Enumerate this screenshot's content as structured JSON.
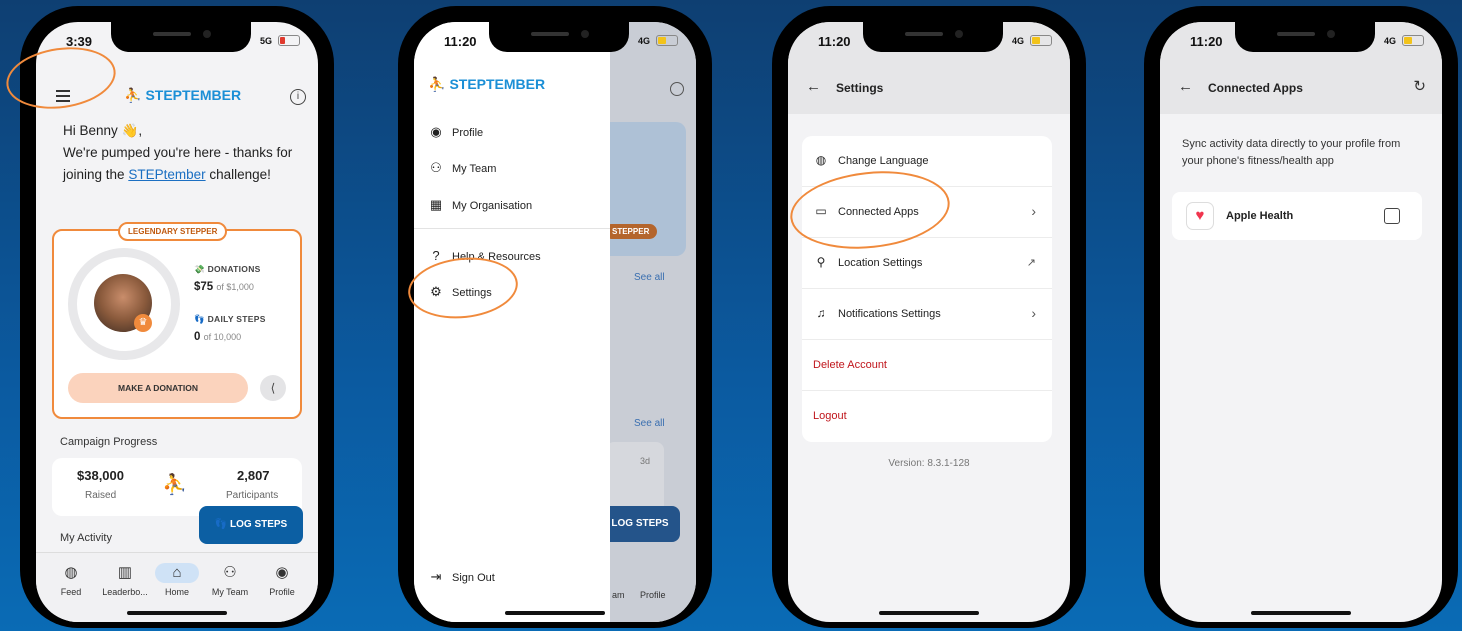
{
  "colors": {
    "accent": "#f08a3c",
    "brand_blue": "#0c5fa3",
    "danger": "#c0161c",
    "background": "#0b5aa0"
  },
  "screen1": {
    "status": {
      "time": "3:39",
      "network": "5G"
    },
    "logo": "STEPTEMBER",
    "greeting": "Hi Benny 👋,",
    "intro_before": "We're pumped you're here - thanks for joining the ",
    "intro_link": "STEPtember",
    "intro_after": " challenge!",
    "badge": "LEGENDARY STEPPER",
    "donations_label": "DONATIONS",
    "donations_value": "$75",
    "donations_goal": "of $1,000",
    "steps_label": "DAILY STEPS",
    "steps_value": "0",
    "steps_goal": "of 10,000",
    "donate_button": "MAKE A DONATION",
    "campaign_title": "Campaign Progress",
    "raised_value": "$38,000",
    "raised_label": "Raised",
    "participants_value": "2,807",
    "participants_label": "Participants",
    "activity_title": "My Activity",
    "log_steps": "LOG STEPS",
    "tabs": [
      "Feed",
      "Leaderbo...",
      "Home",
      "My Team",
      "Profile"
    ]
  },
  "screen2": {
    "status": {
      "time": "11:20",
      "network": "4G"
    },
    "logo": "STEPTEMBER",
    "menu": [
      "Profile",
      "My Team",
      "My Organisation",
      "Help & Resources",
      "Settings"
    ],
    "sign_out": "Sign Out",
    "bg_badge": "STEPPER",
    "bg_see_all_1": "See all",
    "bg_see_all_2": "See all",
    "bg_days": "3d",
    "bg_log_steps": "LOG STEPS",
    "bg_tab_team": "am",
    "bg_tab_profile": "Profile"
  },
  "screen3": {
    "status": {
      "time": "11:20",
      "network": "4G"
    },
    "title": "Settings",
    "rows": [
      "Change Language",
      "Connected Apps",
      "Location Settings",
      "Notifications Settings"
    ],
    "delete": "Delete Account",
    "logout": "Logout",
    "version": "Version: 8.3.1-128"
  },
  "screen4": {
    "status": {
      "time": "11:20",
      "network": "4G"
    },
    "title": "Connected Apps",
    "sync_text": "Sync activity data directly to your profile from your phone's fitness/health app",
    "app_name": "Apple Health"
  }
}
